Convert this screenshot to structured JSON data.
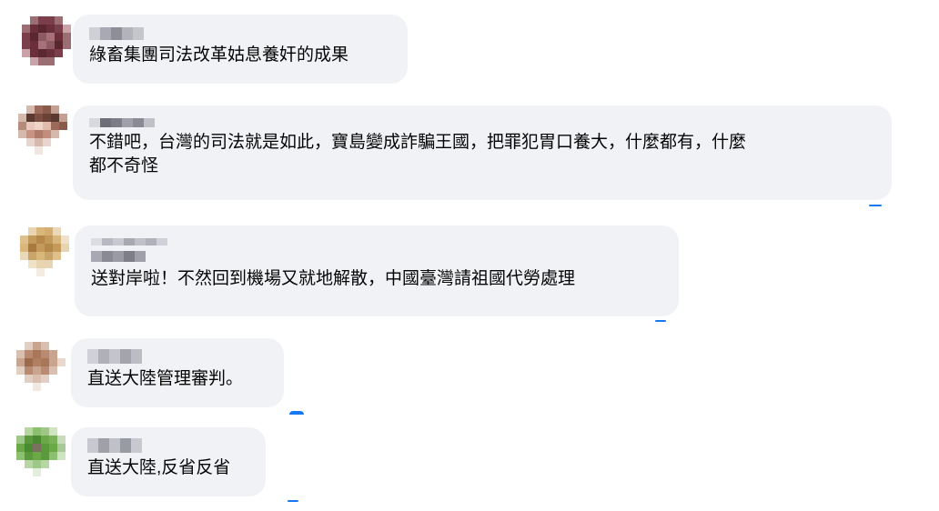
{
  "comments": [
    {
      "text": "綠畜集團司法改革姑息養奸的成果",
      "avatar_color": "#8a4a55"
    },
    {
      "text": "不錯吧，台灣的司法就是如此，寶島變成詐騙王國，把罪犯胃口養大，什麼都有，什麼\n都不奇怪",
      "avatar_color": "#b48a7a"
    },
    {
      "text": "送對岸啦！不然回到機場又就地解散，中國臺灣請祖國代勞處理",
      "avatar_color": "#d9b77a"
    },
    {
      "text": "直送大陸管理審判。",
      "avatar_color": "#b98a70"
    },
    {
      "text": "直送大陸,反省反省",
      "avatar_color": "#6aa848"
    }
  ]
}
